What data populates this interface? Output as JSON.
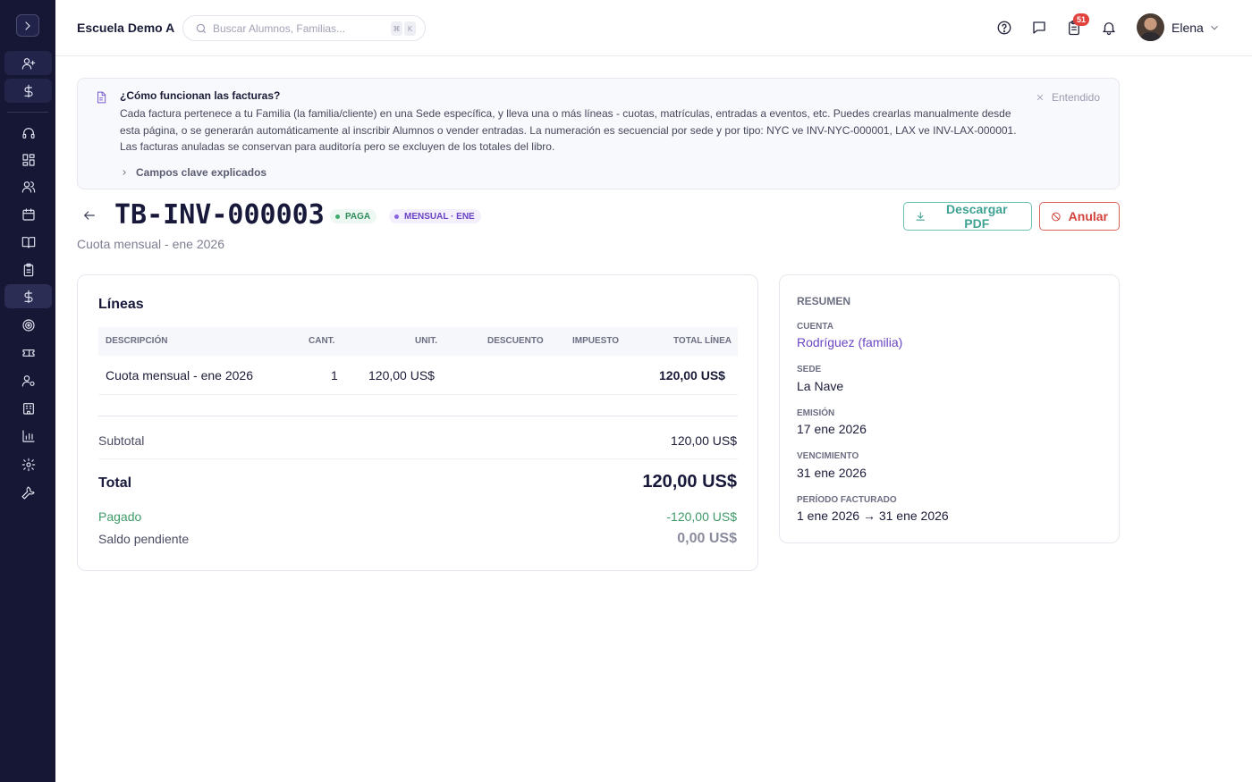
{
  "header": {
    "school_name": "Escuela Demo A",
    "search_placeholder": "Buscar Alumnos, Familias...",
    "shortcut_keys": [
      "⌘",
      "K"
    ],
    "tasks_badge": "51",
    "user_name": "Elena"
  },
  "sidebar": {
    "items": [
      {
        "icon": "user-plus-icon"
      },
      {
        "icon": "dollar-icon"
      },
      {
        "icon": "headset-icon"
      },
      {
        "icon": "dashboard-grid-icon"
      },
      {
        "icon": "users-icon"
      },
      {
        "icon": "calendar-icon"
      },
      {
        "icon": "book-open-icon"
      },
      {
        "icon": "clipboard-icon"
      },
      {
        "icon": "dollar-icon",
        "active": true
      },
      {
        "icon": "target-icon"
      },
      {
        "icon": "ticket-icon"
      },
      {
        "icon": "user-cog-icon"
      },
      {
        "icon": "building-icon"
      },
      {
        "icon": "bar-chart-icon"
      },
      {
        "icon": "settings-icon"
      },
      {
        "icon": "wrench-icon"
      }
    ]
  },
  "banner": {
    "title": "¿Cómo funcionan las facturas?",
    "body": "Cada factura pertenece a tu Familia (la familia/cliente) en una Sede específica, y lleva una o más líneas - cuotas, matrículas, entradas a eventos, etc. Puedes crearlas manualmente desde esta página, o se generarán automáticamente al inscribir Alumnos o vender entradas. La numeración es secuencial por sede y por tipo: NYC ve INV-NYC-000001, LAX ve INV-LAX-000001. Las facturas anuladas se conservan para auditoría pero se excluyen de los totales del libro.",
    "expander": "Campos clave explicados",
    "dismiss": "Entendido"
  },
  "invoice": {
    "number": "TB-INV-000003",
    "status": "PAGA",
    "period_tag": "MENSUAL · ENE",
    "subtitle": "Cuota mensual - ene 2026",
    "download_label": "Descargar PDF",
    "void_label": "Anular"
  },
  "lines": {
    "title": "Líneas",
    "columns": [
      "DESCRIPCIÓN",
      "CANT.",
      "UNIT.",
      "DESCUENTO",
      "IMPUESTO",
      "TOTAL LÍNEA"
    ],
    "rows": [
      {
        "description": "Cuota mensual - ene 2026",
        "qty": "1",
        "unit": "120,00 US$",
        "discount": "",
        "tax": "",
        "total": "120,00 US$"
      }
    ],
    "subtotal_label": "Subtotal",
    "subtotal": "120,00 US$",
    "total_label": "Total",
    "total": "120,00 US$",
    "paid_label": "Pagado",
    "paid": "-120,00 US$",
    "balance_label": "Saldo pendiente",
    "balance": "0,00 US$"
  },
  "summary": {
    "title": "RESUMEN",
    "account_label": "CUENTA",
    "account": "Rodríguez (familia)",
    "site_label": "SEDE",
    "site": "La Nave",
    "issued_label": "EMISIÓN",
    "issued": "17 ene 2026",
    "due_label": "VENCIMIENTO",
    "due": "31 ene 2026",
    "period_label": "PERÍODO FACTURADO",
    "period": "1 ene 2026 → 31 ene 2026"
  },
  "colors": {
    "sidebar_bg": "#161735",
    "accent_purple": "#6a44c4",
    "paid_green": "#3f9a68",
    "pdf_teal": "#3fa393",
    "void_red": "#d2423b"
  }
}
